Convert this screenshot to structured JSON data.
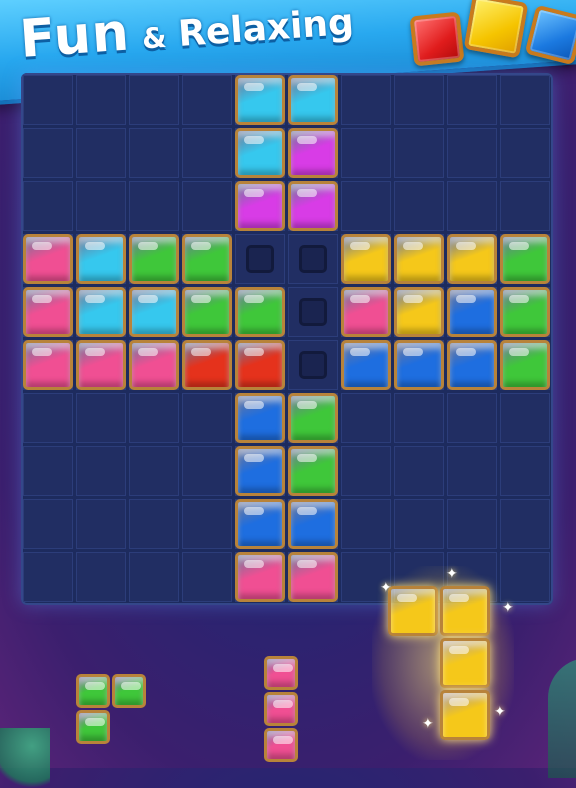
{
  "header": {
    "title_main": "Fun",
    "title_amp": "&",
    "title_sub": "Relaxing",
    "gem_icons": [
      "red-gem-icon",
      "yellow-gem-icon",
      "blue-gem-icon"
    ]
  },
  "colors": {
    "cyan": "#36c8ee",
    "magenta": "#d83ce6",
    "pink": "#f04f93",
    "green": "#3fc73a",
    "yellow": "#f5c81a",
    "blue": "#1e6ee0",
    "red": "#e5321c"
  },
  "board": {
    "rows": 10,
    "cols": 10,
    "grid": [
      [
        ".",
        ".",
        ".",
        ".",
        "c",
        "c",
        ".",
        ".",
        ".",
        "."
      ],
      [
        ".",
        ".",
        ".",
        ".",
        "c",
        "m",
        ".",
        ".",
        ".",
        "."
      ],
      [
        ".",
        ".",
        ".",
        ".",
        "m",
        "m",
        ".",
        ".",
        ".",
        "."
      ],
      [
        "p",
        "c",
        "g",
        "g",
        "o",
        "o",
        "y",
        "y",
        "y",
        "g"
      ],
      [
        "p",
        "c",
        "c",
        "g",
        "g",
        "o",
        "p",
        "y",
        "b",
        "g"
      ],
      [
        "p",
        "p",
        "p",
        "r",
        "r",
        "o",
        "b",
        "b",
        "b",
        "g"
      ],
      [
        ".",
        ".",
        ".",
        ".",
        "b",
        "g",
        ".",
        ".",
        ".",
        "."
      ],
      [
        ".",
        ".",
        ".",
        ".",
        "b",
        "g",
        ".",
        ".",
        ".",
        "."
      ],
      [
        ".",
        ".",
        ".",
        ".",
        "b",
        "b",
        ".",
        ".",
        ".",
        "."
      ],
      [
        ".",
        ".",
        ".",
        ".",
        "p",
        "p",
        ".",
        ".",
        ".",
        "."
      ]
    ]
  },
  "tray": {
    "pieces": [
      {
        "name": "green-s-piece",
        "color": "g",
        "cells": [
          [
            0,
            0
          ],
          [
            0,
            1
          ],
          [
            1,
            0
          ]
        ]
      },
      {
        "name": "pink-i-piece",
        "color": "p",
        "cells": [
          [
            0,
            0
          ],
          [
            1,
            0
          ],
          [
            2,
            0
          ]
        ]
      },
      {
        "name": "yellow-l-piece",
        "color": "y",
        "selected": true,
        "cells": [
          [
            0,
            0
          ],
          [
            0,
            1
          ],
          [
            1,
            1
          ],
          [
            2,
            1
          ]
        ]
      }
    ]
  }
}
